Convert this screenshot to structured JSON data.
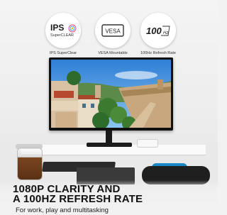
{
  "badges": [
    {
      "icon": "ips-superclear-logo",
      "logo_main": "IPS",
      "logo_sub": "SuperCLEAR",
      "caption": "IPS SuperClear"
    },
    {
      "icon": "vesa-mount-icon",
      "logo_text": "VESA",
      "caption": "VESA Mountable"
    },
    {
      "icon": "refresh-rate-icon",
      "logo_text": "100",
      "logo_unit": "Hz",
      "caption": "100Hz Refresh Rate"
    }
  ],
  "headline": {
    "line1": "1080P CLARITY AND",
    "line2": "A 100HZ REFRESH RATE"
  },
  "subline": "For work, play and multitasking",
  "colors": {
    "accent_blue": "#1e88c7",
    "headline": "#111111"
  }
}
